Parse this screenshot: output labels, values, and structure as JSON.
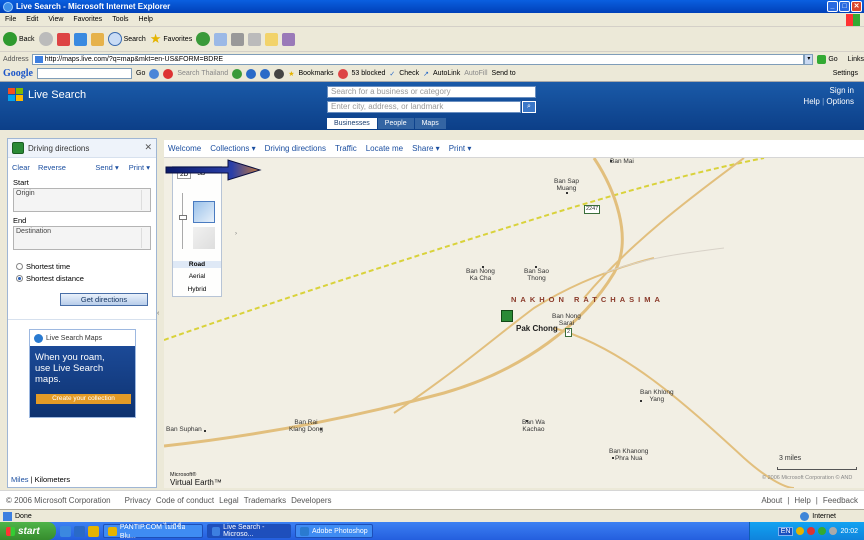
{
  "window": {
    "title": "Live Search - Microsoft Internet Explorer"
  },
  "menu": [
    "File",
    "Edit",
    "View",
    "Favorites",
    "Tools",
    "Help"
  ],
  "toolbar": {
    "back": "Back",
    "search": "Search",
    "favorites": "Favorites"
  },
  "address": {
    "label": "Address",
    "url": "http://maps.live.com/?q=map&mkt=en-US&FORM=BDRE",
    "go": "Go",
    "links": "Links"
  },
  "google_toolbar": {
    "logo": "Google",
    "go": "Go",
    "search_thailand": "Search Thailand",
    "bookmarks": "Bookmarks",
    "blocked": "53 blocked",
    "check": "Check",
    "autolink": "AutoLink",
    "autofill": "AutoFill",
    "send_to": "Send to",
    "settings": "Settings"
  },
  "live_header": {
    "logo_text": "Live Search",
    "search_placeholder": "Search for a business or category",
    "location_placeholder": "Enter city, address, or landmark",
    "tabs": [
      "Businesses",
      "People",
      "Maps"
    ],
    "sign_in": "Sign in",
    "help": "Help",
    "options": "Options"
  },
  "left_pane": {
    "title": "Driving directions",
    "clear": "Clear",
    "reverse": "Reverse",
    "send": "Send",
    "print": "Print",
    "start_label": "Start",
    "start_value": "Origin",
    "end_label": "End",
    "end_value": "Destination",
    "opt_shortest_time": "Shortest time",
    "opt_shortest_distance": "Shortest distance",
    "get_directions": "Get directions",
    "promo": {
      "brand": "Live Search Maps",
      "line1": "When you roam,",
      "line2": "use Live Search maps.",
      "button": "Create your collection"
    },
    "units_miles": "Miles",
    "units_km": "Kilometers"
  },
  "map_nav": [
    "Welcome",
    "Collections",
    "Driving directions",
    "Traffic",
    "Locate me",
    "Share",
    "Print"
  ],
  "map": {
    "zoom_2d": "2D",
    "zoom_3d": "3D",
    "mode_road": "Road",
    "mode_aerial": "Aerial",
    "mode_hybrid": "Hybrid",
    "region": "NAKHON RATCHASIMA",
    "city": "Pak Chong",
    "labels": {
      "ban_mai": "Ban Mai",
      "ban_sap_muang_1": "Ban Sap",
      "ban_sap_muang_2": "Muang",
      "ban_nong_ka_cha_1": "Ban Nong",
      "ban_nong_ka_cha_2": "Ka Cha",
      "ban_sao_thong_1": "Ban Sao",
      "ban_sao_thong_2": "Thong",
      "ban_nong_sarai_1": "Ban Nong",
      "ban_nong_sarai_2": "Sarai",
      "ban_khlong_yang_1": "Ban Khlong",
      "ban_khlong_yang_2": "Yang",
      "ban_suphan": "Ban Suphan",
      "ban_rai_klang_dong_1": "Ban Rai",
      "ban_rai_klang_dong_2": "Klang Dong",
      "ban_wa_kachao_1": "Ban Wa",
      "ban_wa_kachao_2": "Kachao",
      "ban_khanong_phra_nua_1": "Ban Khanong",
      "ban_khanong_phra_nua_2": "Phra Nua"
    },
    "route_2247": "2247",
    "route_2": "2",
    "scale": "3 miles",
    "brand_small": "Microsoft®",
    "brand": "Virtual Earth™",
    "copyright": "© 2006 Microsoft Corporation  © AND"
  },
  "footer": {
    "copyright": "© 2006 Microsoft Corporation",
    "links": [
      "Privacy",
      "Code of conduct",
      "Legal",
      "Trademarks",
      "Developers"
    ],
    "right_links": [
      "About",
      "Help",
      "Feedback"
    ]
  },
  "status": {
    "text": "Done",
    "zone": "Internet"
  },
  "taskbar": {
    "start": "start",
    "tasks": [
      "PANTIP.COM ไม่มีชื่อ Blu...",
      "Live Search - Microso...",
      "Adobe Photoshop"
    ],
    "lang": "EN",
    "clock": "20:02"
  }
}
